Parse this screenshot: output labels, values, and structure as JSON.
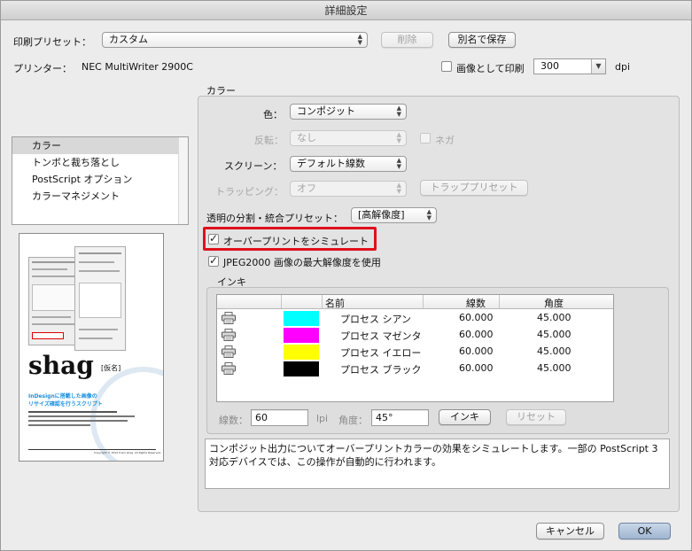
{
  "window": {
    "title": "詳細設定"
  },
  "preset": {
    "label": "印刷プリセット：",
    "value": "カスタム",
    "delete_label": "削除",
    "save_label": "別名で保存"
  },
  "printer": {
    "label": "プリンター：",
    "value": "NEC MultiWriter 2900C",
    "as_image_label": "画像として印刷",
    "dpi_value": "300",
    "dpi_unit": "dpi"
  },
  "sidebar": {
    "items": [
      {
        "label": "カラー"
      },
      {
        "label": "トンボと裁ち落とし"
      },
      {
        "label": "PostScript オプション"
      },
      {
        "label": "カラーマネジメント"
      }
    ]
  },
  "preview": {
    "logo": "shag",
    "logo_sub": "[仮名]",
    "blue_line1": "InDesignに搭載した画像の",
    "blue_line2": "リサイズ確認を行うスクリプト",
    "footer": "Copyright © 2012 trans shag. All Rights Reserved."
  },
  "color": {
    "section_title": "カラー",
    "color_label": "色：",
    "color_value": "コンポジット",
    "flip_label": "反転：",
    "flip_value": "なし",
    "negative_label": "ネガ",
    "screen_label": "スクリーン：",
    "screen_value": "デフォルト線数",
    "trapping_label": "トラッピング：",
    "trapping_value": "オフ",
    "trap_preset_label": "トラッププリセット",
    "flattener_label": "透明の分割・統合プリセット：",
    "flattener_value": "[高解像度]",
    "simulate_overprint_label": "オーバープリントをシミュレート",
    "jpeg2000_label": "JPEG2000 画像の最大解像度を使用"
  },
  "inks": {
    "section_title": "インキ",
    "headers": {
      "name": "名前",
      "frequency": "線数",
      "angle": "角度"
    },
    "rows": [
      {
        "name": "プロセス シアン",
        "frequency": "60.000",
        "angle": "45.000",
        "color": "#00ffff"
      },
      {
        "name": "プロセス マゼンタ",
        "frequency": "60.000",
        "angle": "45.000",
        "color": "#ff00ff"
      },
      {
        "name": "プロセス イエロー",
        "frequency": "60.000",
        "angle": "45.000",
        "color": "#ffff00"
      },
      {
        "name": "プロセス ブラック",
        "frequency": "60.000",
        "angle": "45.000",
        "color": "#000000"
      }
    ],
    "frequency_label": "線数：",
    "frequency_value": "60",
    "lpi": "lpi",
    "angle_label": "角度：",
    "angle_value": "45°",
    "ink_button_label": "インキ",
    "reset_label": "リセット"
  },
  "description": "コンポジット出力についてオーバープリントカラーの効果をシミュレートします。一部の PostScript 3 対応デバイスでは、この操作が自動的に行われます。",
  "footer": {
    "cancel_label": "キャンセル",
    "ok_label": "OK"
  }
}
